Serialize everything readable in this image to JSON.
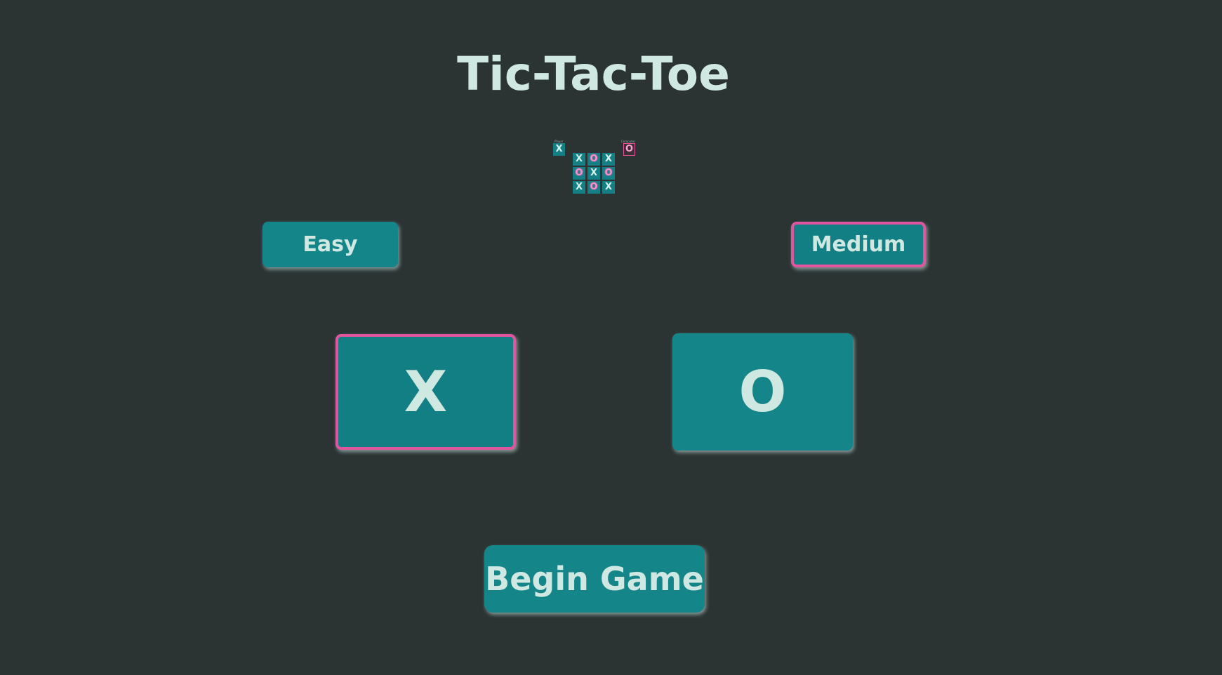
{
  "title": "Tic-Tac-Toe",
  "preview": {
    "player_label": "Player",
    "computer_label": "Computer",
    "player_mark": "X",
    "computer_mark": "O",
    "board": [
      "X",
      "O",
      "X",
      "O",
      "X",
      "O",
      "X",
      "O",
      "X"
    ]
  },
  "difficulty": {
    "easy_label": "Easy",
    "medium_label": "Medium",
    "selected": "Medium"
  },
  "marks": {
    "x_label": "X",
    "o_label": "O",
    "selected": "X"
  },
  "begin_label": "Begin Game",
  "colors": {
    "background": "#2b3333",
    "button": "#148589",
    "text": "#cfe8e1",
    "accent": "#e0559e"
  }
}
